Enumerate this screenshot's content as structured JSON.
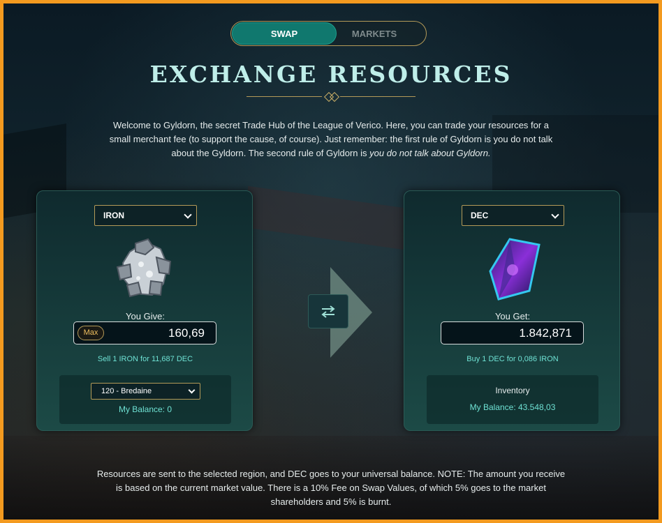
{
  "toggle": {
    "swap_label": "SWAP",
    "markets_label": "MARKETS"
  },
  "title": "EXCHANGE RESOURCES",
  "intro": {
    "text": "Welcome to Gyldorn, the secret Trade Hub of the League of Verico. Here, you can trade your resources for a small merchant fee (to support the cause, of course). Just remember: the first rule of Gyldorn is you do not talk about the Gyldorn. The second rule of Gyldorn is ",
    "emphasis": "you do not talk about Gyldorn."
  },
  "give_panel": {
    "resource_select": "IRON",
    "label": "You Give:",
    "max_label": "Max",
    "amount": "160,69",
    "rate": "Sell 1 IRON for 11,687 DEC",
    "region_select": "120 - Bredaine",
    "balance": "My Balance: 0",
    "icon": "iron-ore-icon"
  },
  "get_panel": {
    "resource_select": "DEC",
    "label": "You Get:",
    "amount": "1.842,871",
    "rate": "Buy 1 DEC for 0,086 IRON",
    "inventory_label": "Inventory",
    "balance": "My Balance: 43.548,03",
    "icon": "dec-crystal-icon"
  },
  "swap_icon": "swap-arrows-icon",
  "footer": "Resources are sent to the selected region, and DEC goes to your universal balance. NOTE: The amount you receive is based on the current market value. There is a 10% Fee on Swap Values, of which 5% goes to the market shareholders and 5% is burnt.",
  "colors": {
    "accent_teal": "#10786e",
    "gold_border": "#b49a58",
    "cyan_text": "#6fe2d4",
    "title_text": "#bfeee9",
    "outer_border": "#f39a1f"
  }
}
